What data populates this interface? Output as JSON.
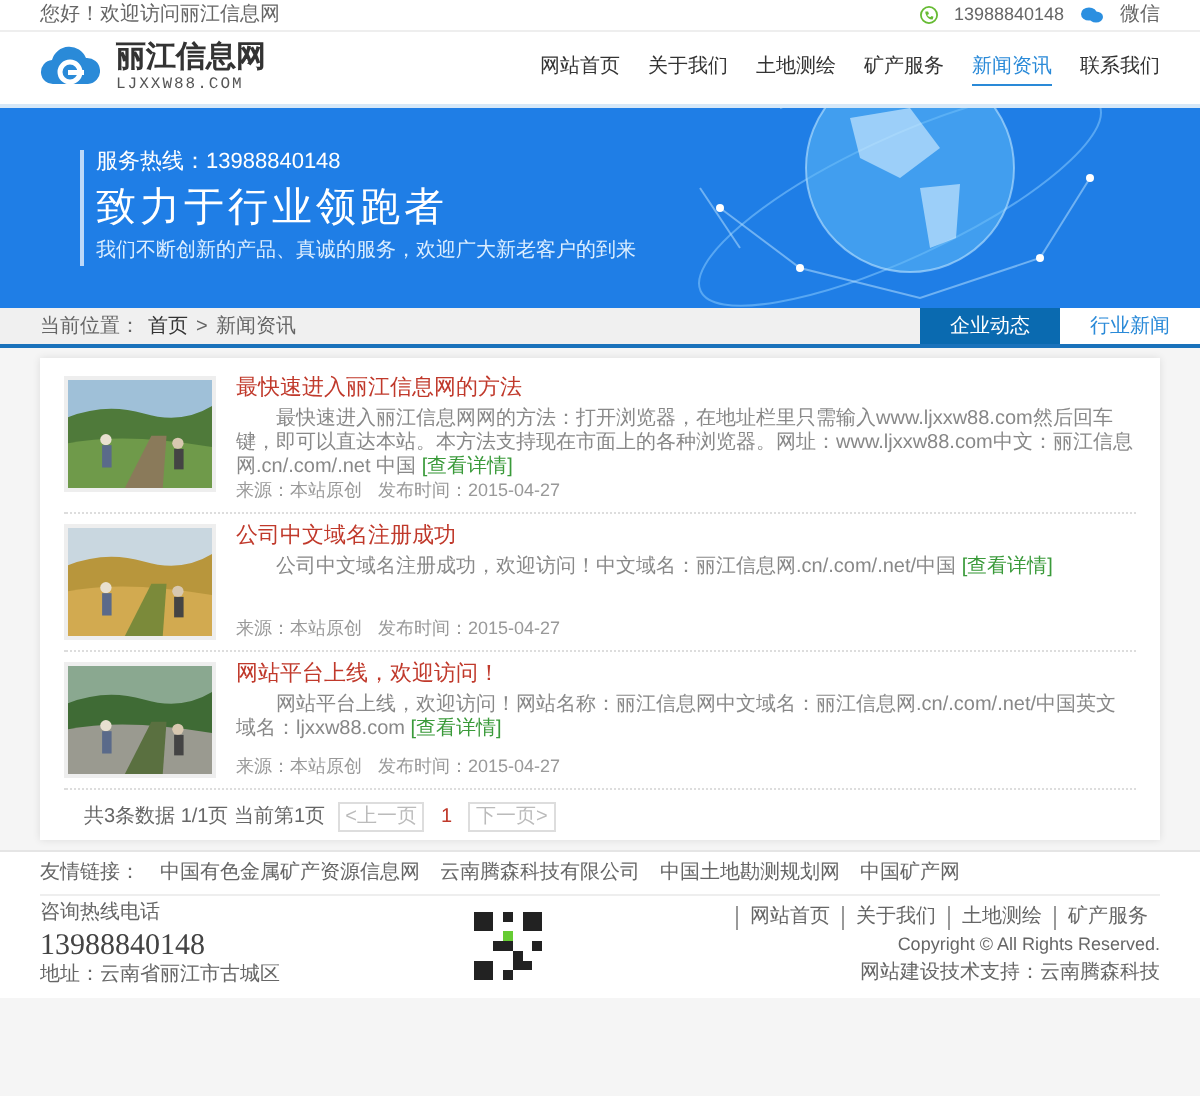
{
  "top_bar": {
    "greeting": "您好！欢迎访问丽江信息网",
    "phone": "13988840148",
    "wechat": "微信"
  },
  "header": {
    "logo_title": "丽江信息网",
    "logo_domain": "LJXXW88.COM",
    "nav": [
      {
        "label": "网站首页",
        "selected": false
      },
      {
        "label": "关于我们",
        "selected": false
      },
      {
        "label": "土地测绘",
        "selected": false
      },
      {
        "label": "矿产服务",
        "selected": false
      },
      {
        "label": "新闻资讯",
        "selected": true
      },
      {
        "label": "联系我们",
        "selected": false
      }
    ]
  },
  "banner": {
    "hotline": "服务热线：13988840148",
    "slogan": "致力于行业领跑者",
    "subtitle": "我们不断创新的产品、真诚的服务，欢迎广大新老客户的到来"
  },
  "breadcrumb": {
    "prefix": "当前位置：",
    "items": [
      "首页",
      ">",
      "新闻资讯"
    ]
  },
  "tabs": [
    {
      "label": "企业动态",
      "selected": true
    },
    {
      "label": "行业新闻",
      "selected": false
    }
  ],
  "articles": [
    {
      "title": "最快速进入丽江信息网的方法",
      "summary": "最快速进入丽江信息网网的方法：打开浏览器，在地址栏里只需输入www.ljxxw88.com然后回车键，即可以直达本站。本方法支持现在市面上的各种浏览器。网址：www.ljxxw88.com中文：丽江信息网.cn/.com/.net 中国",
      "more": "[查看详情]",
      "source": "来源：本站原创",
      "date": "发布时间：2015-04-27",
      "kind": "picture"
    },
    {
      "title": "公司中文域名注册成功",
      "summary": "公司中文域名注册成功，欢迎访问！中文域名：丽江信息网.cn/.com/.net/中国",
      "more": "[查看详情]",
      "source": "来源：本站原创",
      "date": "发布时间：2015-04-27",
      "kind": "picture"
    },
    {
      "title": "网站平台上线，欢迎访问！",
      "summary": "网站平台上线，欢迎访问！网站名称：丽江信息网中文域名：丽江信息网.cn/.com/.net/中国英文域名：ljxxw88.com",
      "more": "[查看详情]",
      "source": "来源：本站原创",
      "date": "发布时间：2015-04-27",
      "kind": "picture"
    }
  ],
  "pagination": {
    "info": "共3条数据 1/1页 当前第1页",
    "prev": "<上一页",
    "pages": [
      {
        "label": "1",
        "selected": true
      }
    ],
    "next": "下一页>"
  },
  "footer": {
    "links_label": "友情链接：",
    "links": [
      "中国有色金属矿产资源信息网",
      "云南腾森科技有限公司",
      "中国土地勘测规划网",
      "中国矿产网"
    ],
    "hotline_label": "咨询热线电话",
    "hotline": "13988840148",
    "address": "地址：云南省丽江市古城区",
    "nav": [
      "网站首页",
      "关于我们",
      "土地测绘",
      "矿产服务"
    ],
    "copyright": "Copyright © All Rights Reserved.",
    "support": "网站建设技术支持：云南腾森科技"
  }
}
